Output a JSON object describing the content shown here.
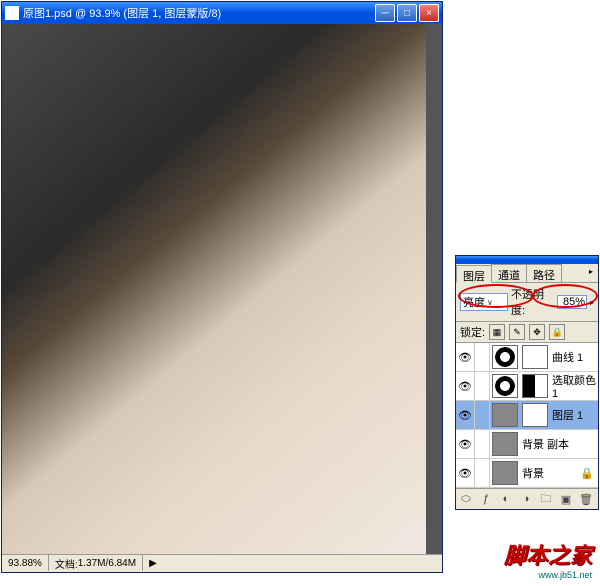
{
  "mainWindow": {
    "title": "原图1.psd @ 93.9% (图层 1, 图层蒙版/8)",
    "status": {
      "zoom": "93.88%",
      "docLabel": "文档:",
      "docSize": "1.37M/6.84M"
    }
  },
  "layersPanel": {
    "tabs": [
      "图层",
      "通道",
      "路径"
    ],
    "blendMode": "亮度",
    "opacityLabel": "不透明度:",
    "opacityValue": "85%",
    "lockLabel": "锁定:",
    "layers": [
      {
        "name": "曲线 1",
        "type": "adj"
      },
      {
        "name": "选取颜色 1",
        "type": "adj"
      },
      {
        "name": "图层 1",
        "type": "img",
        "selected": true
      },
      {
        "name": "背景 副本",
        "type": "img"
      },
      {
        "name": "背景",
        "type": "img",
        "locked": true
      }
    ]
  },
  "watermark": {
    "cn": "脚本之家",
    "en": "www.jb51.net"
  }
}
